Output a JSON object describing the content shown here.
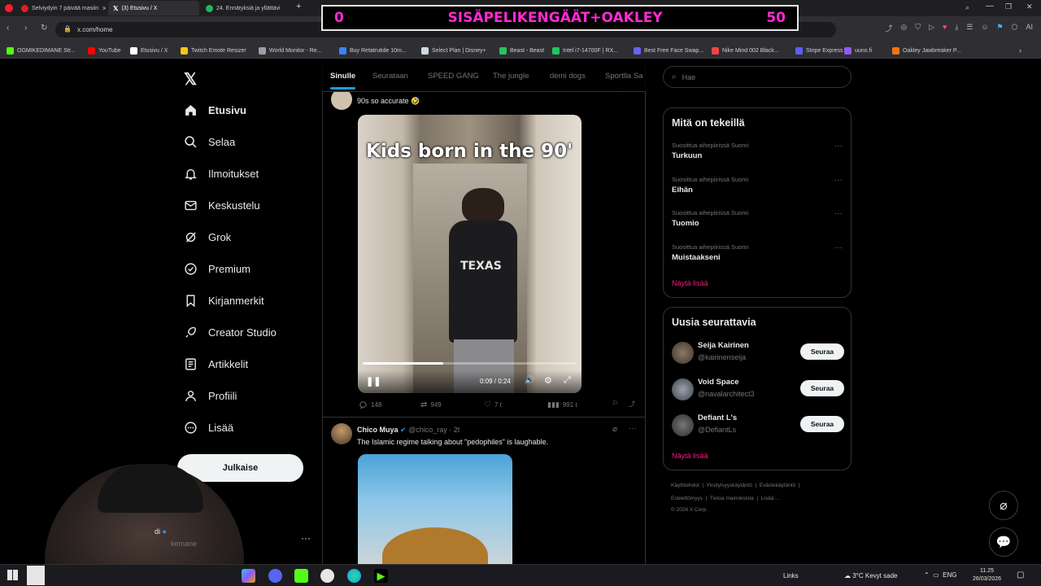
{
  "browser": {
    "tabs": [
      {
        "title": "Selviydyin 7 päivää masiin",
        "active": false,
        "color": "#e11d2e"
      },
      {
        "title": "(3) Etusivu / X",
        "active": true,
        "color": "#ffffff"
      },
      {
        "title": "24. Ennätyksiä ja yllättävi",
        "active": false,
        "color": "#1db954"
      }
    ],
    "new_tab": "+",
    "url": "x.com/home",
    "bookmarks": [
      {
        "label": "OGMIKEDIMANE Str...",
        "color": "#53fc18"
      },
      {
        "label": "YouTube",
        "color": "#ff0000"
      },
      {
        "label": "Etusivu / X",
        "color": "#ffffff"
      },
      {
        "label": "Twitch Emote Resizer",
        "color": "#f5c518"
      },
      {
        "label": "World Monitor - Re...",
        "color": "#9aa0a6"
      },
      {
        "label": "Buy Retatrutide 10m...",
        "color": "#3b82f6"
      },
      {
        "label": "Select Plan | Disney+",
        "color": "#cfd8e3"
      },
      {
        "label": "Beast - Beast",
        "color": "#22c55e"
      },
      {
        "label": "Intel i7-14700F | RX...",
        "color": "#22c55e"
      },
      {
        "label": "Best Free Face Swap...",
        "color": "#6366f1"
      },
      {
        "label": "Nike Mind 002 Black...",
        "color": "#ef4444"
      },
      {
        "label": "Stripe Express",
        "color": "#635bff"
      },
      {
        "label": "uuno.fi",
        "color": "#8b5cf6"
      },
      {
        "label": "Oakley Jawbreaker P...",
        "color": "#f97316"
      }
    ]
  },
  "overlay": {
    "left": "0",
    "title": "SISÄPELIKENGÄÄT+OAKLEY",
    "right": "50"
  },
  "nav": {
    "items": [
      {
        "label": "Etusivu",
        "icon": "home-icon",
        "active": true
      },
      {
        "label": "Selaa",
        "icon": "search-icon"
      },
      {
        "label": "Ilmoitukset",
        "icon": "bell-icon"
      },
      {
        "label": "Keskustelu",
        "icon": "mail-icon"
      },
      {
        "label": "Grok",
        "icon": "grok-icon"
      },
      {
        "label": "Premium",
        "icon": "premium-icon"
      },
      {
        "label": "Kirjanmerkit",
        "icon": "bookmark-icon"
      },
      {
        "label": "Creator Studio",
        "icon": "rocket-icon"
      },
      {
        "label": "Artikkelit",
        "icon": "article-icon"
      },
      {
        "label": "Profiili",
        "icon": "person-icon"
      },
      {
        "label": "Lisää",
        "icon": "more-circle-icon"
      }
    ],
    "post_button": "Julkaise",
    "account": {
      "name": "di",
      "handle": "kemane"
    }
  },
  "timeline": {
    "tabs": [
      "Sinulle",
      "Seurataan",
      "SPEED GANG",
      "The jungle",
      "demi dogs",
      "Sportlla Sa"
    ],
    "active_tab": 0,
    "post1": {
      "text": "90s so accurate 🤣",
      "video_caption": "Kids born in the 90'",
      "time": "0:09 / 0:24",
      "progress": 0.375,
      "replies": "148",
      "reposts": "949",
      "likes": "7 t",
      "views": "991 t"
    },
    "post2": {
      "name": "Chico Muya",
      "handle": "@chico_ray",
      "time": "2t",
      "text": "The Islamic regime talking about \"pedophiles\" is laughable."
    }
  },
  "sidebar": {
    "search_placeholder": "Hae",
    "trending": {
      "title": "Mitä on tekeillä",
      "items": [
        {
          "context": "Suosittua aihepiirissä Suomi",
          "name": "Turkuun"
        },
        {
          "context": "Suosittua aihepiirissä Suomi",
          "name": "Eihän"
        },
        {
          "context": "Suosittua aihepiirissä Suomi",
          "name": "Tuomio"
        },
        {
          "context": "Suosittua aihepiirissä Suomi",
          "name": "Muistaakseni"
        }
      ],
      "show_more": "Näytä lisää"
    },
    "who_to_follow": {
      "title": "Uusia seurattavia",
      "items": [
        {
          "name": "Seija Kairinen",
          "handle": "@kairinenseija",
          "button": "Seuraa"
        },
        {
          "name": "Void Space",
          "handle": "@navalarchitect3",
          "button": "Seuraa"
        },
        {
          "name": "Defiant L's",
          "handle": "@DefiantLs",
          "button": "Seuraa"
        }
      ],
      "show_more": "Näytä lisää"
    },
    "footer": {
      "links": [
        "Käyttöehdot",
        "Yksityisyyskäytäntö",
        "Evästekäytäntö",
        "Esteettömyys",
        "Tietoa mainoksista",
        "Lisää ..."
      ],
      "copyright": "© 2026 X Corp."
    }
  },
  "taskbar": {
    "links": "Links",
    "weather": "3°C  Kevyt sade",
    "lang": "ENG",
    "time": "11.25",
    "date": "26/03/2026"
  },
  "colors": {
    "accent": "#1d9bf0",
    "pink": "#f91880",
    "overlay_text": "#ff2ad4"
  }
}
